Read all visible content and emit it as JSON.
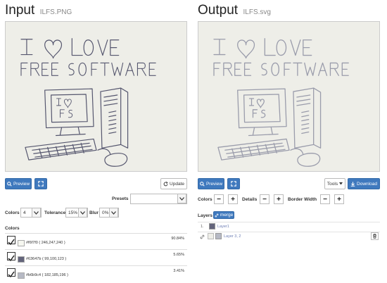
{
  "input": {
    "title": "Input",
    "filename": "ILFS.PNG",
    "preview_label": "Preview",
    "update_label": "Update",
    "presets_label": "Presets",
    "presets_value": "",
    "colors_label": "Colors",
    "colors_value": "4",
    "tolerance_label": "Tolerance",
    "tolerance_value": "15%",
    "blur_label": "Blur",
    "blur_value": "0%",
    "colors_section": "Colors",
    "colors_list": [
      {
        "hex": "#f6f7f0",
        "label": "#f6f7f0 ( 246,247,240 )",
        "pct": "90.84%",
        "color": "#f6f7f0"
      },
      {
        "hex": "#63647b",
        "label": "#63647b ( 99,100,123 )",
        "pct": "5.65%",
        "color": "#63647b"
      },
      {
        "hex": "#b6b9c4",
        "label": "#b6b9c4 ( 182,185,196 )",
        "pct": "3.41%",
        "color": "#b6b9c4"
      }
    ]
  },
  "output": {
    "title": "Output",
    "filename": "ILFS.svg",
    "preview_label": "Preview",
    "tools_label": "Tools",
    "download_label": "Download",
    "colors_label": "Colors",
    "details_label": "Details",
    "border_width_label": "Border Width",
    "minus": "−",
    "plus": "+",
    "layers_label": "Layers",
    "merge_label": "merge",
    "layers": [
      {
        "index": "1.",
        "name": "Layer1",
        "color": "#63647b"
      },
      {
        "index": "",
        "name": "Layer 3, 2",
        "color": "#b6b9c4"
      }
    ]
  },
  "drawing": {
    "line1": "I ♡ LOVE",
    "line2": "FREE SOFTWARE",
    "screen": "I♡ FS"
  },
  "theme": {
    "primary": "#3f79be",
    "drawing_ink": "#63647b",
    "paper": "#eeeee8"
  }
}
